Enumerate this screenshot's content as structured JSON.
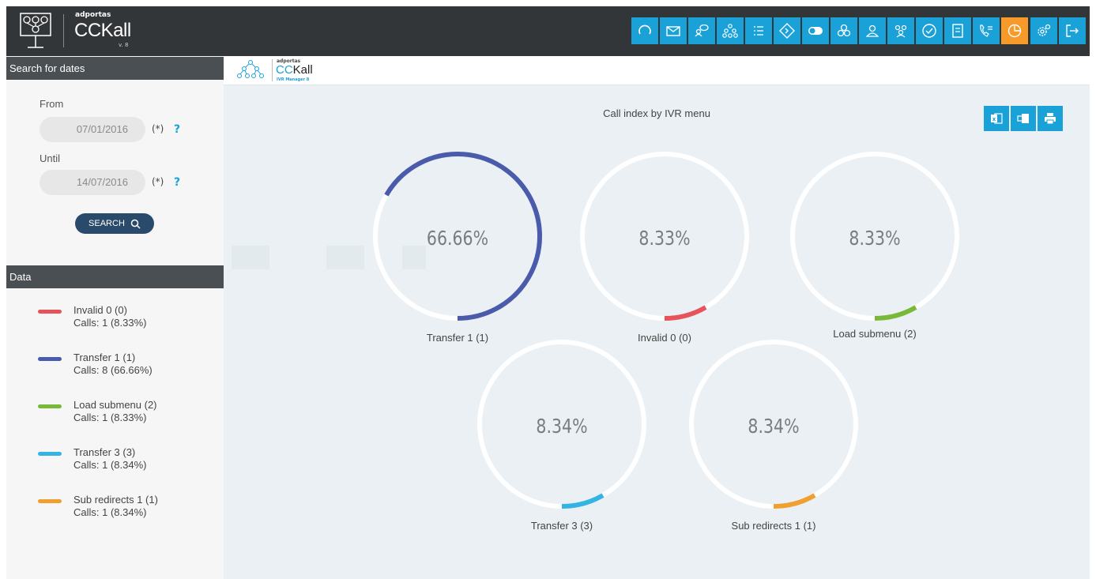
{
  "app": {
    "brand": "adportas",
    "name": "CCKall",
    "version": "v. 8"
  },
  "toolbar": {
    "buttons": [
      {
        "name": "refresh-icon"
      },
      {
        "name": "mail-icon"
      },
      {
        "name": "chat-users-icon"
      },
      {
        "name": "ivr-tree-icon"
      },
      {
        "name": "list-icon"
      },
      {
        "name": "routing-diamond-icon"
      },
      {
        "name": "toggle-icon"
      },
      {
        "name": "groups-icon"
      },
      {
        "name": "user-icon"
      },
      {
        "name": "users-icon"
      },
      {
        "name": "check-circle-icon"
      },
      {
        "name": "document-icon"
      },
      {
        "name": "phone-list-icon"
      },
      {
        "name": "pie-chart-icon",
        "active": true
      }
    ],
    "right_buttons": [
      {
        "name": "settings-icon"
      },
      {
        "name": "logout-icon"
      }
    ],
    "accent": "#1aa1d8",
    "active_color": "#f79a2a"
  },
  "sidebar": {
    "search_header": "Search for dates",
    "from_label": "From",
    "from_value": "07/01/2016",
    "until_label": "Until",
    "until_value": "14/07/2016",
    "required_mark": "(*)",
    "help_mark": "?",
    "search_button": "SEARCH",
    "data_header": "Data",
    "legend": [
      {
        "name": "Invalid 0 (0)",
        "calls": "Calls: 1 (8.33%)",
        "color": "#e8525a"
      },
      {
        "name": "Transfer 1 (1)",
        "calls": "Calls: 8 (66.66%)",
        "color": "#4a5bab"
      },
      {
        "name": "Load submenu (2)",
        "calls": "Calls: 1 (8.33%)",
        "color": "#7ab83a"
      },
      {
        "name": "Transfer 3 (3)",
        "calls": "Calls: 1 (8.34%)",
        "color": "#35b4e3"
      },
      {
        "name": "Sub redirects 1 (1)",
        "calls": "Calls: 1 (8.34%)",
        "color": "#f0a030"
      }
    ]
  },
  "subheader": {
    "brand": "adportas",
    "name_cc": "CC",
    "name_rest": "Kall",
    "product": "IVR Manager 8"
  },
  "chart_data": {
    "type": "pie",
    "title": "Call index by IVR menu",
    "series": [
      {
        "name": "Transfer 1 (1)",
        "percent": 66.66,
        "label": "66.66%",
        "color": "#4a5bab"
      },
      {
        "name": "Invalid 0 (0)",
        "percent": 8.33,
        "label": "8.33%",
        "color": "#e8525a"
      },
      {
        "name": "Load submenu (2)",
        "percent": 8.33,
        "label": "8.33%",
        "color": "#7ab83a"
      },
      {
        "name": "Transfer 3 (3)",
        "percent": 8.34,
        "label": "8.34%",
        "color": "#35b4e3"
      },
      {
        "name": "Sub redirects 1 (1)",
        "percent": 8.34,
        "label": "8.34%",
        "color": "#f0a030"
      }
    ]
  },
  "export": [
    {
      "name": "excel-export-icon"
    },
    {
      "name": "pdf-export-icon"
    },
    {
      "name": "print-icon"
    }
  ]
}
